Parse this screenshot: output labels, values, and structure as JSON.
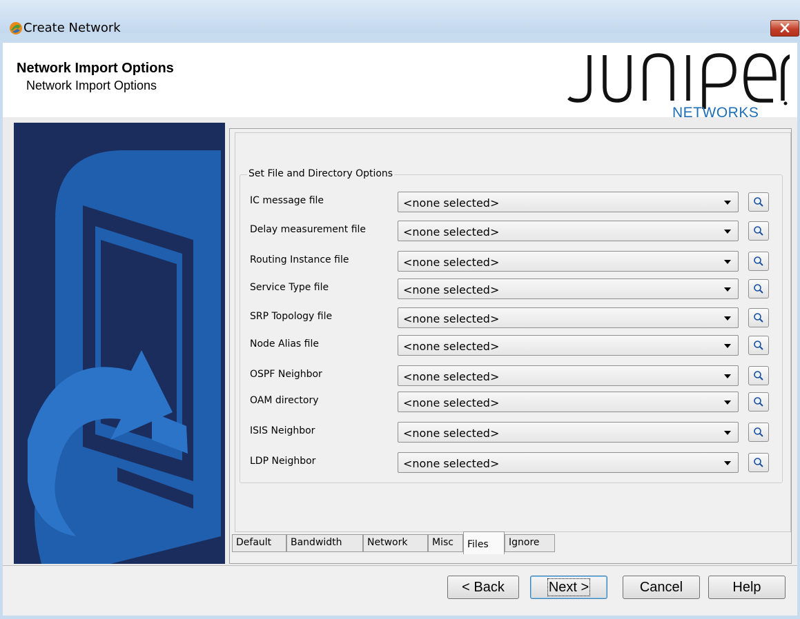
{
  "window": {
    "title": "Create Network",
    "close_icon": "close-icon"
  },
  "header": {
    "title": "Network Import Options",
    "subtitle": "Network Import Options",
    "logo_text": "JUNIPer",
    "logo_subtext": "NETWORKS"
  },
  "group": {
    "legend": "Set File and Directory Options"
  },
  "rows": [
    {
      "label": "IC message file",
      "value": "<none selected>"
    },
    {
      "label": "Delay measurement file",
      "value": "<none selected>"
    },
    {
      "label": "Routing Instance file",
      "value": "<none selected>"
    },
    {
      "label": "Service Type file",
      "value": "<none selected>"
    },
    {
      "label": "SRP Topology file",
      "value": "<none selected>"
    },
    {
      "label": "Node Alias file",
      "value": "<none selected>"
    },
    {
      "label": "OSPF Neighbor",
      "value": "<none selected>"
    },
    {
      "label": "OAM directory",
      "value": "<none selected>"
    },
    {
      "label": "ISIS Neighbor",
      "value": "<none selected>"
    },
    {
      "label": "LDP Neighbor",
      "value": "<none selected>"
    }
  ],
  "tabs": [
    {
      "label": "Default"
    },
    {
      "label": "Bandwidth"
    },
    {
      "label": "Network"
    },
    {
      "label": "Misc"
    },
    {
      "label": "Files",
      "active": true
    },
    {
      "label": "Ignore"
    }
  ],
  "buttons": {
    "back": "< Back",
    "next": "Next >",
    "cancel": "Cancel",
    "help": "Help"
  },
  "colors": {
    "titlebar": "#c8dcf0",
    "side_panel": "#1b2d5c",
    "accent_blue": "#1e6fb8",
    "close": "#c4402a"
  }
}
